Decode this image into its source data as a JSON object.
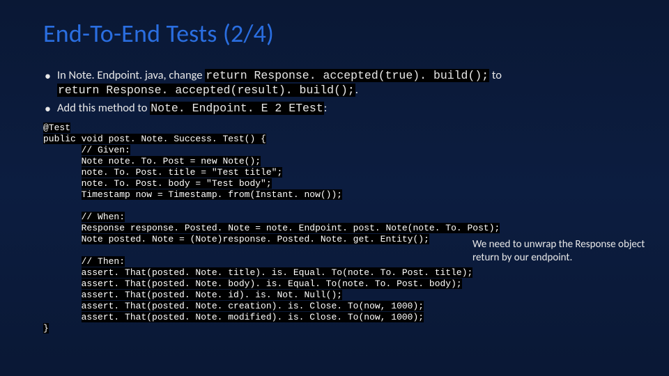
{
  "title": "End-To-End Tests (2/4)",
  "bullets": [
    {
      "pre": "In Note. Endpoint. java, change ",
      "code1": "return Response. accepted(true). build();",
      "mid": " to ",
      "code2": "return Response. accepted(result). build();",
      "post": "."
    },
    {
      "pre": "Add this method to ",
      "code1": "Note. Endpoint. E 2 ETest",
      "post": ":"
    }
  ],
  "annotation": "We need to unwrap the Response object return by our endpoint.",
  "code_lines": [
    "@Test",
    "public void post. Note. Success. Test() {",
    "       // Given:",
    "       Note note. To. Post = new Note();",
    "       note. To. Post. title = \"Test title\";",
    "       note. To. Post. body = \"Test body\";",
    "       Timestamp now = Timestamp. from(Instant. now());",
    "",
    "       // When:",
    "       Response response. Posted. Note = note. Endpoint. post. Note(note. To. Post);",
    "       Note posted. Note = (Note)response. Posted. Note. get. Entity();",
    "",
    "       // Then:",
    "       assert. That(posted. Note. title). is. Equal. To(note. To. Post. title);",
    "       assert. That(posted. Note. body). is. Equal. To(note. To. Post. body);",
    "       assert. That(posted. Note. id). is. Not. Null();",
    "       assert. That(posted. Note. creation). is. Close. To(now, 1000);",
    "       assert. That(posted. Note. modified). is. Close. To(now, 1000);",
    "}"
  ]
}
